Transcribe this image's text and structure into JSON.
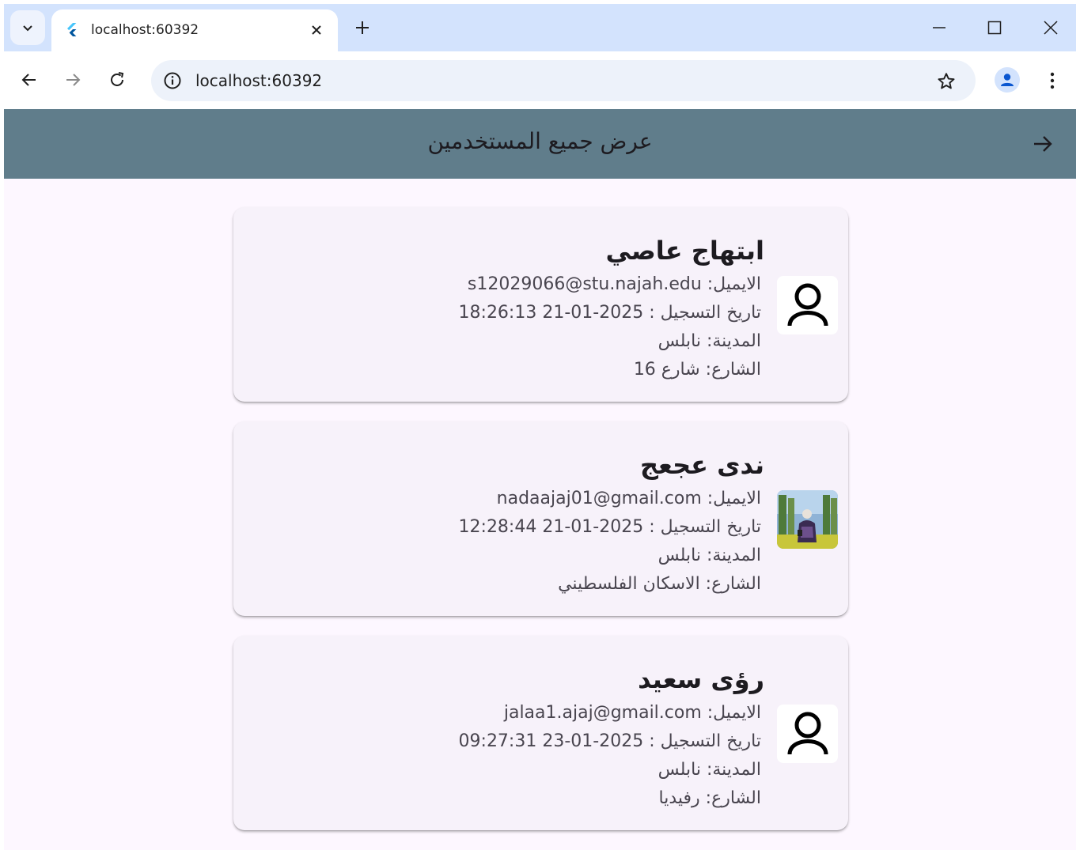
{
  "browser": {
    "tab_title": "localhost:60392",
    "url": "localhost:60392"
  },
  "appbar": {
    "title": "عرض جميع المستخدمين",
    "back_icon": "arrow-right-icon"
  },
  "users": [
    {
      "name": "ابتهاج عاصي",
      "email": "الايميل: s12029066@stu.najah.edu",
      "registered": "تاريخ التسجيل : 2025-01-21 18:26:13",
      "city": "المدينة: نابلس",
      "street": "الشارع: شارع 16",
      "avatar": "person-outline-icon"
    },
    {
      "name": "ندى عجعج",
      "email": "الايميل: nadaajaj01@gmail.com",
      "registered": "تاريخ التسجيل : 2025-01-21 12:28:44",
      "city": "المدينة: نابلس",
      "street": "الشارع: الاسكان الفلسطيني",
      "avatar": "user-photo"
    },
    {
      "name": "رؤى سعيد",
      "email": "الايميل: jalaa1.ajaj@gmail.com",
      "registered": "تاريخ التسجيل : 2025-01-23 09:27:31",
      "city": "المدينة: نابلس",
      "street": "الشارع: رفيديا",
      "avatar": "person-outline-icon"
    }
  ],
  "colors": {
    "appbar": "#607d8b",
    "background": "#fdf7ff",
    "card": "#f7f2fa",
    "tabbar": "#d3e3fd"
  }
}
